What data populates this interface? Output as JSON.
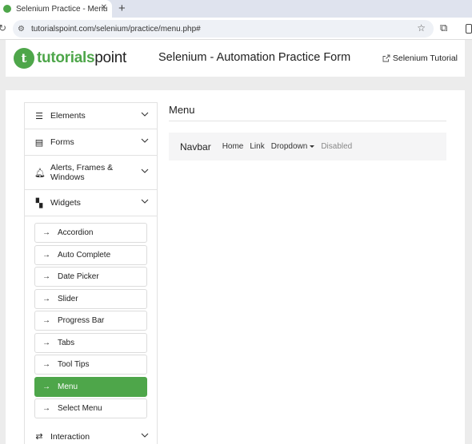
{
  "browser": {
    "tab_title": "Selenium Practice - Menu",
    "tab_close_icon": "close-icon",
    "new_tab_icon": "plus-icon",
    "url": "tutorialspoint.com/selenium/practice/menu.php#"
  },
  "header": {
    "logo_text_green": "tutorials",
    "logo_text_dark": "point",
    "title": "Selenium - Automation Practice Form",
    "tutorial_link": "Selenium Tutorial"
  },
  "sidebar": {
    "sections": [
      {
        "label": "Elements",
        "icon": "hamburger-icon"
      },
      {
        "label": "Forms",
        "icon": "form-icon"
      },
      {
        "label": "Alerts, Frames &",
        "label_line2": "Windows",
        "icon": "bell-icon"
      },
      {
        "label": "Widgets",
        "icon": "widgets-icon"
      }
    ],
    "widget_items": [
      "Accordion",
      "Auto Complete",
      "Date Picker",
      "Slider",
      "Progress Bar",
      "Tabs",
      "Tool Tips",
      "Menu",
      "Select Menu"
    ],
    "active_item": "Menu",
    "next_section": {
      "label": "Interaction",
      "icon": "arrows-icon"
    }
  },
  "content": {
    "title": "Menu",
    "navbar": {
      "brand": "Navbar",
      "links": [
        "Home",
        "Link",
        "Dropdown",
        "Disabled"
      ]
    }
  },
  "colors": {
    "accent": "#4ea64a",
    "navbar_bg": "#f5f5f6"
  }
}
